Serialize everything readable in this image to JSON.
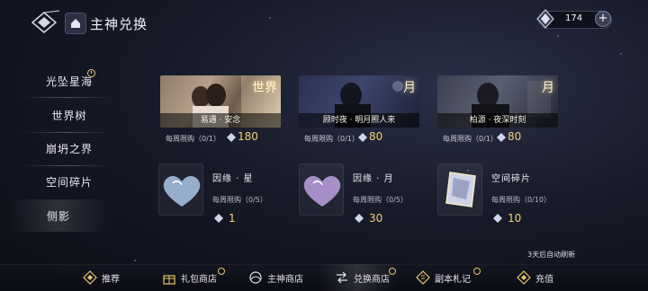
{
  "header": {
    "title": "主神兑换",
    "currency_value": "174",
    "plus_label": "+"
  },
  "sidebar": {
    "items": [
      {
        "label": "光坠星海"
      },
      {
        "label": "世界树"
      },
      {
        "label": "崩坍之界"
      },
      {
        "label": "空间碎片"
      },
      {
        "label": "侧影"
      }
    ]
  },
  "cards": [
    {
      "caption": "易遇 · 安念",
      "tag": "世界",
      "limit": "每周限购（0/1）",
      "price": "180"
    },
    {
      "caption": "顾时夜 · 明月照人来",
      "tag": "月",
      "limit": "每周限购（0/1）",
      "price": "80"
    },
    {
      "caption": "柏源 · 夜深时刻",
      "tag": "月",
      "limit": "每周限购（0/1）",
      "price": "80"
    }
  ],
  "items": [
    {
      "name": "因缘 · 星",
      "limit": "每周限购（0/5）",
      "price": "1"
    },
    {
      "name": "因缘 · 月",
      "limit": "每周限购（0/5）",
      "price": "30"
    },
    {
      "name": "空间碎片",
      "limit": "每周限购（0/10）",
      "price": "10"
    }
  ],
  "refresh_note": "3天后自动刷新",
  "bottom_nav": [
    {
      "label": "推荐"
    },
    {
      "label": "礼包商店"
    },
    {
      "label": "主神商店"
    },
    {
      "label": "兑换商店"
    },
    {
      "label": "副本札记"
    },
    {
      "label": "充值"
    }
  ],
  "colors": {
    "price": "#f0d078",
    "clock_badge": "#e9c86a",
    "bg": "#171a28"
  }
}
